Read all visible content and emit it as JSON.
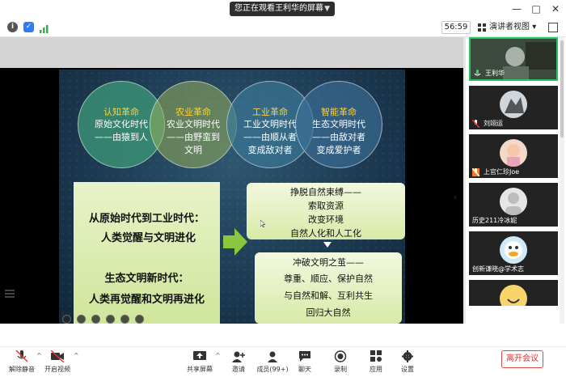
{
  "window": {
    "sharing_title": "您正在观看王利华的屏幕",
    "minimize_label": "—",
    "maximize_label": "□",
    "close_label": "✕",
    "caret": "▼"
  },
  "infobar": {
    "timer": "56:59",
    "view_label": "演讲者视图",
    "view_caret": "▾"
  },
  "slide": {
    "circles": [
      {
        "title": "认知革命",
        "lines": [
          "原始文化时代",
          "——由猿到人"
        ]
      },
      {
        "title": "农业革命",
        "lines": [
          "农业文明时代",
          "——由野蛮到",
          "文明"
        ]
      },
      {
        "title": "工业革命",
        "lines": [
          "工业文明时代",
          "——由顺从者",
          "变成敌对者"
        ]
      },
      {
        "title": "智能革命",
        "lines": [
          "生态文明时代",
          "——由敌对者",
          "变成爱护者"
        ]
      }
    ],
    "left_box": {
      "line1": "从原始时代到工业时代：",
      "line2": "人类觉醒与文明进化",
      "line3": "生态文明新时代：",
      "line4": "人类再觉醒和文明再进化"
    },
    "right_box_1": [
      "挣脱自然束缚——",
      "索取资源",
      "改变环境",
      "自然人化和人工化"
    ],
    "right_box_2": [
      "冲破文明之茧——",
      "尊重、顺应、保护自然",
      "与自然和解、互利共生",
      "回归大自然"
    ],
    "accent_colors": {
      "circle_title": "#ffd23a",
      "arrow": "#8cc63f",
      "box_green": "#cfe59a"
    }
  },
  "split_chevron": "›",
  "participants": [
    {
      "name": "王利华",
      "muted": false
    },
    {
      "name": "刘翊运",
      "muted": true
    },
    {
      "name": "上官仁珍Joe",
      "muted": true
    },
    {
      "name": "历史211冷冰妮",
      "muted": false
    },
    {
      "name": "创新谦晓@学术志",
      "muted": false
    },
    {
      "name": "",
      "muted": false
    }
  ],
  "toolbar": {
    "unmute": "解除静音",
    "start_video": "开启视频",
    "share_screen": "共享屏幕",
    "invite": "邀请",
    "members": "成员(99+)",
    "chat": "聊天",
    "record": "录制",
    "apps": "应用",
    "settings": "设置",
    "leave": "离开会议",
    "caret": "^"
  }
}
